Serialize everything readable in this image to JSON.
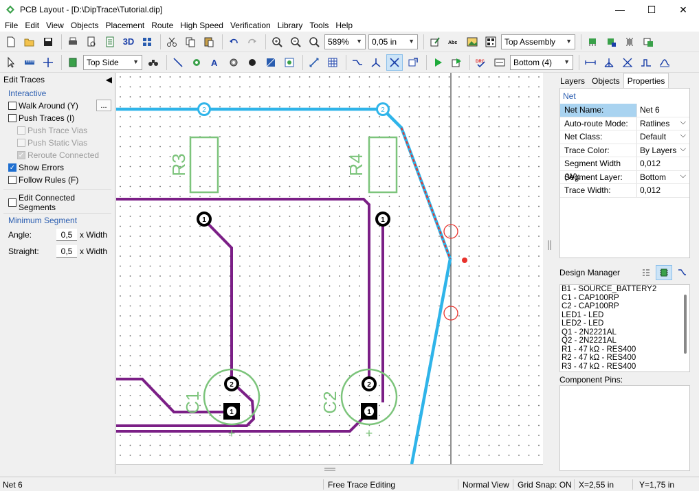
{
  "window": {
    "title": "PCB Layout - [D:\\DipTrace\\Tutorial.dip]",
    "minimize": "—",
    "maximize": "☐",
    "close": "✕"
  },
  "menu": [
    "File",
    "Edit",
    "View",
    "Objects",
    "Placement",
    "Route",
    "High Speed",
    "Verification",
    "Library",
    "Tools",
    "Help"
  ],
  "toolbar1": {
    "view_3d": "3D",
    "zoom": "589%",
    "grid": "0,05 in",
    "assembly": "Top Assembly"
  },
  "toolbar2": {
    "side": "Top Side",
    "layer": "Bottom (4)"
  },
  "left_panel": {
    "title": "Edit Traces",
    "interactive_title": "Interactive",
    "walk_around": "Walk Around (Y)",
    "walk_btn": "...",
    "push_traces": "Push Traces (I)",
    "push_trace_vias": "Push Trace Vias",
    "push_static_vias": "Push Static Vias",
    "reroute_connected": "Reroute Connected",
    "show_errors": "Show Errors",
    "follow_rules": "Follow Rules (F)",
    "edit_connected": "Edit Connected Segments",
    "min_segment_title": "Minimum Segment",
    "angle_label": "Angle:",
    "angle_value": "0,5",
    "straight_label": "Straight:",
    "straight_value": "0,5",
    "width_unit": "x Width",
    "checks": {
      "walk_around": false,
      "push_traces": false,
      "push_trace_vias": false,
      "push_static_vias": false,
      "reroute_connected": true,
      "show_errors": true,
      "follow_rules": false,
      "edit_connected": false
    }
  },
  "canvas": {
    "r3": "R3",
    "r4": "R4",
    "c1": "C1",
    "c2": "C2",
    "pin1": "1",
    "pin2": "2",
    "plus": "+"
  },
  "right_panel": {
    "tabs": [
      "Layers",
      "Objects",
      "Properties"
    ],
    "active_tab": 2,
    "props_header": "Net",
    "rows": [
      {
        "k": "Net Name:",
        "v": "Net 6",
        "dd": false
      },
      {
        "k": "Auto-route Mode:",
        "v": "Ratlines",
        "dd": true
      },
      {
        "k": "Net Class:",
        "v": "Default",
        "dd": true
      },
      {
        "k": "Trace Color:",
        "v": "By Layers",
        "dd": true
      },
      {
        "k": "Segment Width (W):",
        "v": "0,012",
        "dd": false
      },
      {
        "k": "Segment Layer:",
        "v": "Bottom",
        "dd": true
      },
      {
        "k": "Trace Width:",
        "v": "0,012",
        "dd": false
      }
    ],
    "dm_title": "Design Manager",
    "dm_items": [
      "B1 - SOURCE_BATTERY2",
      "C1 - CAP100RP",
      "C2 - CAP100RP",
      "LED1 - LED",
      "LED2 - LED",
      "Q1 - 2N2221AL",
      "Q2 - 2N2221AL",
      "R1 - 47 kΩ - RES400",
      "R2 - 47 kΩ - RES400",
      "R3 - 47 kΩ - RES400"
    ],
    "cp_title": "Component Pins:"
  },
  "status": {
    "net": "Net 6",
    "mode": "Free Trace Editing",
    "view": "Normal View",
    "snap": "Grid Snap: ON",
    "x": "X=2,55 in",
    "y": "Y=1,75 in"
  },
  "colors": {
    "trace_top": "#2fb4e9",
    "trace_purple": "#7b1f86",
    "silk": "#7cc47b",
    "error": "#e8322c",
    "accent": "#1f6fd0"
  }
}
